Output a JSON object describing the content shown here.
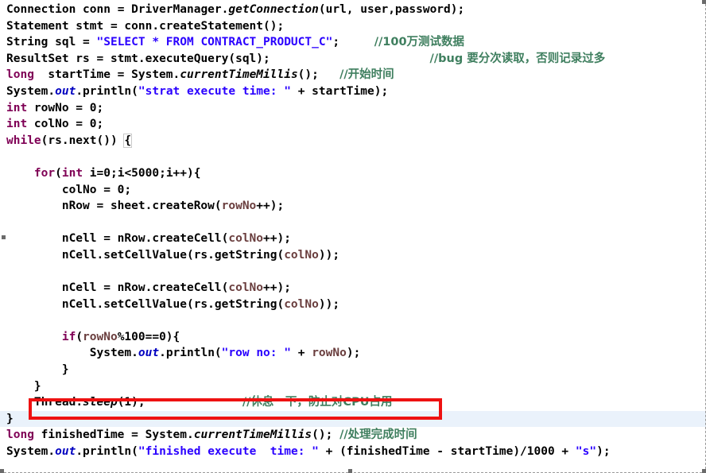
{
  "editor": {
    "language": "Java",
    "colors": {
      "keyword": "#7f0055",
      "string": "#2a00ff",
      "comment": "#3f7f5f",
      "variable": "#6a3e3e",
      "static_field": "#0000c0",
      "plain": "#000000",
      "current_line_highlight": "#eaf2fb",
      "annotation_rectangle": "#ee1111",
      "background": "#ffffff"
    },
    "annotation": {
      "type": "red-rectangle",
      "target_line": "Thread.sleep(1);    //休息一下，防止对CPU占用"
    }
  },
  "lines": [
    {
      "id": 1,
      "tokens": [
        {
          "t": "Connection",
          "c": "typ"
        },
        {
          "t": " conn = ",
          "c": "pun"
        },
        {
          "t": "DriverManager",
          "c": "typ"
        },
        {
          "t": ".",
          "c": "pun"
        },
        {
          "t": "getConnection",
          "c": "mth"
        },
        {
          "t": "(url, user,password);",
          "c": "pun"
        }
      ]
    },
    {
      "id": 2,
      "tokens": [
        {
          "t": "Statement",
          "c": "typ"
        },
        {
          "t": " stmt = conn.createStatement();",
          "c": "pun"
        }
      ]
    },
    {
      "id": 3,
      "tokens": [
        {
          "t": "String",
          "c": "typ"
        },
        {
          "t": " sql = ",
          "c": "pun"
        },
        {
          "t": "\"SELECT * FROM CONTRACT_PRODUCT_C\"",
          "c": "str"
        },
        {
          "t": ";",
          "c": "pun"
        },
        {
          "t": "     ",
          "c": "pun"
        },
        {
          "t": "//100万测试数据",
          "c": "cmt cmt-cn"
        }
      ]
    },
    {
      "id": 4,
      "tokens": [
        {
          "t": "ResultSet",
          "c": "typ"
        },
        {
          "t": " rs = stmt.executeQuery(sql);",
          "c": "pun"
        },
        {
          "t": "                       ",
          "c": "pun"
        },
        {
          "t": "//bug 要分次读取，否则记录过多",
          "c": "cmt cmt-cn"
        }
      ]
    },
    {
      "id": 5,
      "tokens": [
        {
          "t": "long",
          "c": "kw"
        },
        {
          "t": "  startTime = ",
          "c": "pun"
        },
        {
          "t": "System",
          "c": "typ"
        },
        {
          "t": ".",
          "c": "pun"
        },
        {
          "t": "currentTimeMillis",
          "c": "mth"
        },
        {
          "t": "();",
          "c": "pun"
        },
        {
          "t": "   ",
          "c": "pun"
        },
        {
          "t": "//开始时间",
          "c": "cmt cmt-cn"
        }
      ]
    },
    {
      "id": 6,
      "tokens": [
        {
          "t": "System",
          "c": "typ"
        },
        {
          "t": ".",
          "c": "pun"
        },
        {
          "t": "out",
          "c": "fld"
        },
        {
          "t": ".println(",
          "c": "pun"
        },
        {
          "t": "\"strat execute time: \"",
          "c": "str"
        },
        {
          "t": " + startTime);",
          "c": "pun"
        }
      ]
    },
    {
      "id": 7,
      "tokens": [
        {
          "t": "int",
          "c": "kw"
        },
        {
          "t": " rowNo = 0;",
          "c": "pun"
        }
      ]
    },
    {
      "id": 8,
      "tokens": [
        {
          "t": "int",
          "c": "kw"
        },
        {
          "t": " colNo = 0;",
          "c": "pun"
        }
      ]
    },
    {
      "id": 9,
      "tokens": [
        {
          "t": "while",
          "c": "kw"
        },
        {
          "t": "(rs.next()) ",
          "c": "pun"
        },
        {
          "t": "{",
          "c": "pun brkmatch"
        }
      ]
    },
    {
      "id": 10,
      "blank": true,
      "tokens": []
    },
    {
      "id": 11,
      "tokens": [
        {
          "t": "    ",
          "c": "pun"
        },
        {
          "t": "for",
          "c": "kw"
        },
        {
          "t": "(",
          "c": "pun"
        },
        {
          "t": "int",
          "c": "kw"
        },
        {
          "t": " i=0;i<5000;i++){",
          "c": "pun"
        }
      ]
    },
    {
      "id": 12,
      "tokens": [
        {
          "t": "        colNo = 0;",
          "c": "pun"
        }
      ]
    },
    {
      "id": 13,
      "tokens": [
        {
          "t": "        nRow = sheet.createRow(",
          "c": "pun"
        },
        {
          "t": "rowNo",
          "c": "var"
        },
        {
          "t": "++);",
          "c": "pun"
        }
      ]
    },
    {
      "id": 14,
      "blank": true,
      "tokens": []
    },
    {
      "id": 15,
      "tokens": [
        {
          "t": "        nCell = nRow.createCell(",
          "c": "pun"
        },
        {
          "t": "colNo",
          "c": "var"
        },
        {
          "t": "++);",
          "c": "pun"
        }
      ]
    },
    {
      "id": 16,
      "tokens": [
        {
          "t": "        nCell.setCellValue(rs.getString(",
          "c": "pun"
        },
        {
          "t": "colNo",
          "c": "var"
        },
        {
          "t": "));",
          "c": "pun"
        }
      ]
    },
    {
      "id": 17,
      "blank": true,
      "tokens": []
    },
    {
      "id": 18,
      "tokens": [
        {
          "t": "        nCell = nRow.createCell(",
          "c": "pun"
        },
        {
          "t": "colNo",
          "c": "var"
        },
        {
          "t": "++);",
          "c": "pun"
        }
      ]
    },
    {
      "id": 19,
      "tokens": [
        {
          "t": "        nCell.setCellValue(rs.getString(",
          "c": "pun"
        },
        {
          "t": "colNo",
          "c": "var"
        },
        {
          "t": "));",
          "c": "pun"
        }
      ]
    },
    {
      "id": 20,
      "blank": true,
      "tokens": []
    },
    {
      "id": 21,
      "tokens": [
        {
          "t": "        ",
          "c": "pun"
        },
        {
          "t": "if",
          "c": "kw"
        },
        {
          "t": "(",
          "c": "pun"
        },
        {
          "t": "rowNo",
          "c": "var"
        },
        {
          "t": "%100==0){",
          "c": "pun"
        }
      ]
    },
    {
      "id": 22,
      "tokens": [
        {
          "t": "            ",
          "c": "pun"
        },
        {
          "t": "System",
          "c": "typ"
        },
        {
          "t": ".",
          "c": "pun"
        },
        {
          "t": "out",
          "c": "fld"
        },
        {
          "t": ".println(",
          "c": "pun"
        },
        {
          "t": "\"row no: \"",
          "c": "str"
        },
        {
          "t": " + ",
          "c": "pun"
        },
        {
          "t": "rowNo",
          "c": "var"
        },
        {
          "t": ");",
          "c": "pun"
        }
      ]
    },
    {
      "id": 23,
      "tokens": [
        {
          "t": "        }",
          "c": "pun"
        }
      ]
    },
    {
      "id": 24,
      "tokens": [
        {
          "t": "    }",
          "c": "pun"
        }
      ]
    },
    {
      "id": 25,
      "tokens": [
        {
          "t": "    ",
          "c": "pun"
        },
        {
          "t": "Thread",
          "c": "typ"
        },
        {
          "t": ".",
          "c": "pun"
        },
        {
          "t": "sleep",
          "c": "mth"
        },
        {
          "t": "(1);",
          "c": "pun"
        },
        {
          "t": "              ",
          "c": "pun"
        },
        {
          "t": "//休息一下，防止对CPU占用",
          "c": "cmt cmt-cn"
        }
      ]
    },
    {
      "id": 26,
      "current": true,
      "tokens": [
        {
          "t": "}",
          "c": "pun"
        }
      ]
    },
    {
      "id": 27,
      "tokens": [
        {
          "t": "long",
          "c": "kw"
        },
        {
          "t": " finishedTime = ",
          "c": "pun"
        },
        {
          "t": "System",
          "c": "typ"
        },
        {
          "t": ".",
          "c": "pun"
        },
        {
          "t": "currentTimeMillis",
          "c": "mth"
        },
        {
          "t": "();",
          "c": "pun"
        },
        {
          "t": " ",
          "c": "pun"
        },
        {
          "t": "//处理完成时间",
          "c": "cmt cmt-cn"
        }
      ]
    },
    {
      "id": 28,
      "tokens": [
        {
          "t": "System",
          "c": "typ"
        },
        {
          "t": ".",
          "c": "pun"
        },
        {
          "t": "out",
          "c": "fld"
        },
        {
          "t": ".println(",
          "c": "pun"
        },
        {
          "t": "\"finished execute  time: \"",
          "c": "str"
        },
        {
          "t": " + (finishedTime - startTime)/1000 + ",
          "c": "pun"
        },
        {
          "t": "\"s\"",
          "c": "str"
        },
        {
          "t": ");",
          "c": "pun"
        }
      ]
    }
  ]
}
